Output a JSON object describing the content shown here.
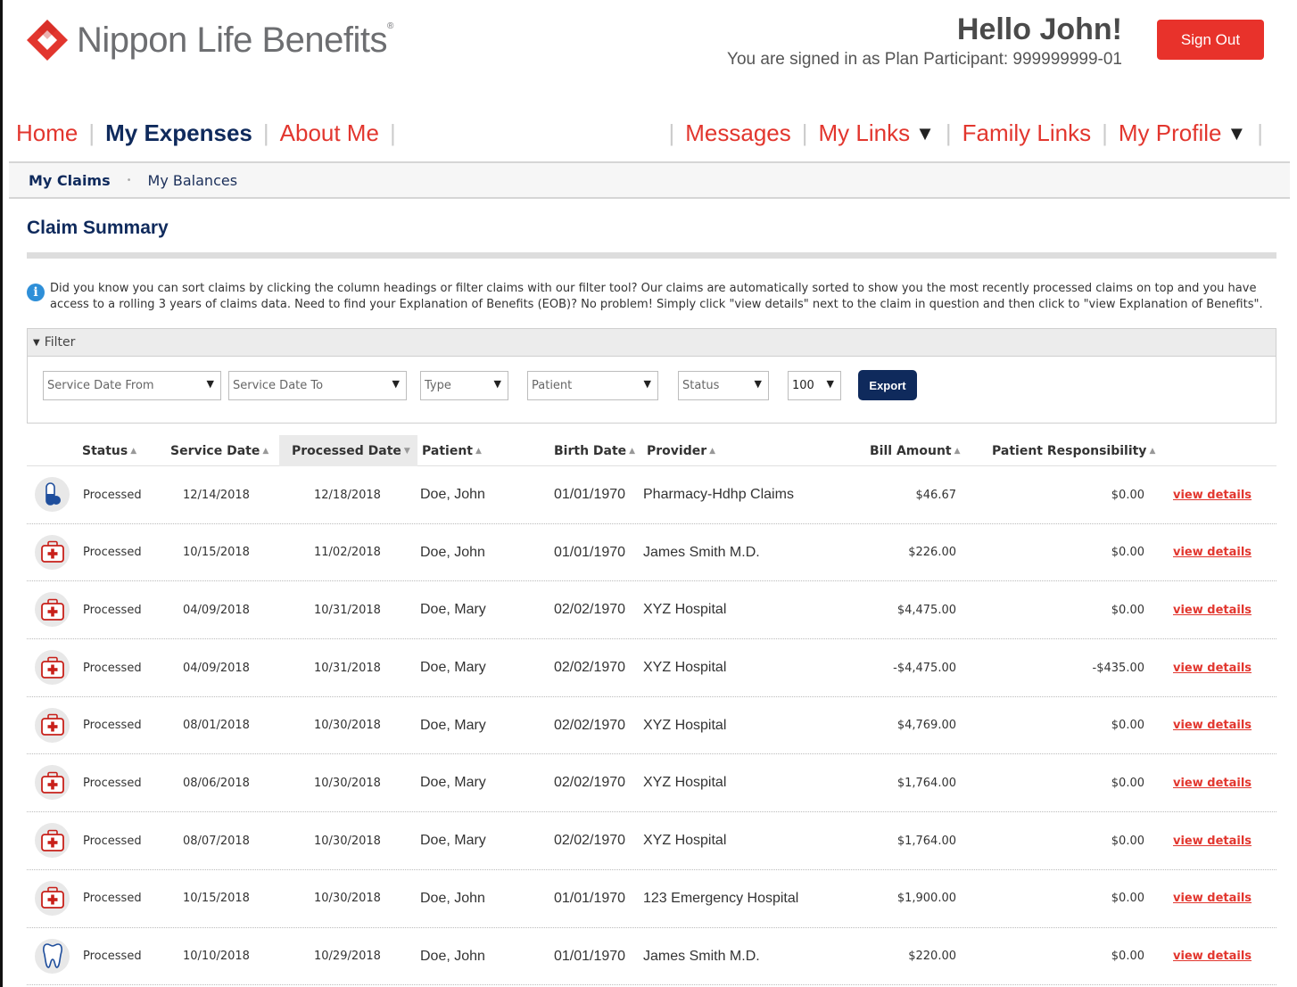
{
  "header": {
    "brand": "Nippon Life Benefits",
    "brand_reg": "®",
    "greeting": "Hello John!",
    "signed_in": "You are signed in as Plan Participant: 999999999-01",
    "sign_out": "Sign Out"
  },
  "nav": {
    "left": [
      "Home",
      "My Expenses",
      "About Me"
    ],
    "active": "My Expenses",
    "right": [
      "Messages",
      "My Links",
      "Family Links",
      "My Profile"
    ],
    "caret": "▼"
  },
  "subnav": {
    "active": "My Claims",
    "item": "My Balances",
    "dot": "•"
  },
  "page": {
    "title": "Claim Summary",
    "info_icon": "i",
    "info": "Did you know you can sort claims by clicking the column headings or filter claims with our filter tool? Our claims are automatically sorted to show you the most recently processed claims on top and you have access to a rolling 3 years of claims data. Need to find your Explanation of Benefits (EOB)? No problem! Simply click \"view details\" next to the claim in question and then click to \"view Explanation of Benefits\"."
  },
  "filter": {
    "heading": "Filter",
    "service_from": "Service Date From",
    "service_to": "Service Date To",
    "type": "Type",
    "patient": "Patient",
    "status": "Status",
    "page_size": "100",
    "export": "Export"
  },
  "table": {
    "headers": {
      "status": "Status",
      "service_date": "Service Date",
      "processed_date": "Processed Date",
      "patient": "Patient",
      "birth_date": "Birth Date",
      "provider": "Provider",
      "bill_amount": "Bill Amount",
      "patient_responsibility": "Patient Responsibility"
    },
    "rows": [
      {
        "icon": "pharmacy-capsule-icon",
        "status": "Processed",
        "service_date": "12/14/2018",
        "processed_date": "12/18/2018",
        "patient": "Doe, John",
        "birth_date": "01/01/1970",
        "provider": "Pharmacy-Hdhp Claims",
        "bill": "$46.67",
        "resp": "$0.00",
        "action": "view details"
      },
      {
        "icon": "medical-kit-icon",
        "status": "Processed",
        "service_date": "10/15/2018",
        "processed_date": "11/02/2018",
        "patient": "Doe, John",
        "birth_date": "01/01/1970",
        "provider": "James Smith M.D.",
        "bill": "$226.00",
        "resp": "$0.00",
        "action": "view details"
      },
      {
        "icon": "medical-kit-icon",
        "status": "Processed",
        "service_date": "04/09/2018",
        "processed_date": "10/31/2018",
        "patient": "Doe, Mary",
        "birth_date": "02/02/1970",
        "provider": "XYZ Hospital",
        "bill": "$4,475.00",
        "resp": "$0.00",
        "action": "view details"
      },
      {
        "icon": "medical-kit-icon",
        "status": "Processed",
        "service_date": "04/09/2018",
        "processed_date": "10/31/2018",
        "patient": "Doe, Mary",
        "birth_date": "02/02/1970",
        "provider": "XYZ Hospital",
        "bill": "-$4,475.00",
        "resp": "-$435.00",
        "action": "view details"
      },
      {
        "icon": "medical-kit-icon",
        "status": "Processed",
        "service_date": "08/01/2018",
        "processed_date": "10/30/2018",
        "patient": "Doe, Mary",
        "birth_date": "02/02/1970",
        "provider": "XYZ Hospital",
        "bill": "$4,769.00",
        "resp": "$0.00",
        "action": "view details"
      },
      {
        "icon": "medical-kit-icon",
        "status": "Processed",
        "service_date": "08/06/2018",
        "processed_date": "10/30/2018",
        "patient": "Doe, Mary",
        "birth_date": "02/02/1970",
        "provider": "XYZ Hospital",
        "bill": "$1,764.00",
        "resp": "$0.00",
        "action": "view details"
      },
      {
        "icon": "medical-kit-icon",
        "status": "Processed",
        "service_date": "08/07/2018",
        "processed_date": "10/30/2018",
        "patient": "Doe, Mary",
        "birth_date": "02/02/1970",
        "provider": "XYZ Hospital",
        "bill": "$1,764.00",
        "resp": "$0.00",
        "action": "view details"
      },
      {
        "icon": "medical-kit-icon",
        "status": "Processed",
        "service_date": "10/15/2018",
        "processed_date": "10/30/2018",
        "patient": "Doe, John",
        "birth_date": "01/01/1970",
        "provider": "123 Emergency Hospital",
        "bill": "$1,900.00",
        "resp": "$0.00",
        "action": "view details"
      },
      {
        "icon": "tooth-icon",
        "status": "Processed",
        "service_date": "10/10/2018",
        "processed_date": "10/29/2018",
        "patient": "Doe, John",
        "birth_date": "01/01/1970",
        "provider": "James Smith M.D.",
        "bill": "$220.00",
        "resp": "$0.00",
        "action": "view details"
      }
    ]
  },
  "colors": {
    "accent_red": "#e2362e",
    "navy": "#0f2a5c",
    "info_blue": "#2e8fd8"
  }
}
